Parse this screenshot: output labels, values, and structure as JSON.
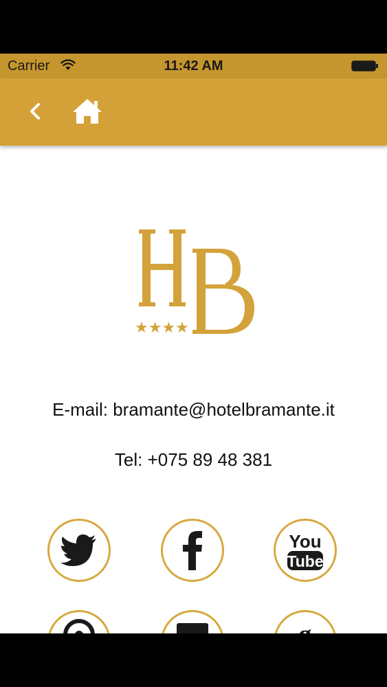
{
  "status_bar": {
    "carrier": "Carrier",
    "time": "11:42 AM"
  },
  "nav": {
    "back_icon": "chevron-left-icon",
    "home_icon": "home-icon"
  },
  "logo": {
    "letters": "HB",
    "stars": "★★★★"
  },
  "contact": {
    "email": "E-mail: bramante@hotelbramante.it",
    "tel": "Tel: +075 89 48 381"
  },
  "social": {
    "youtube_top": "You",
    "youtube_bottom": "Tube",
    "icons": [
      "twitter-icon",
      "facebook-icon",
      "youtube-icon",
      "pinterest-icon",
      "email-icon",
      "google-plus-icon"
    ]
  },
  "colors": {
    "status_bar": "#c6962e",
    "nav_bar": "#d3a137",
    "gold": "#d8a83e",
    "logo_gold": "#d4a23a"
  }
}
